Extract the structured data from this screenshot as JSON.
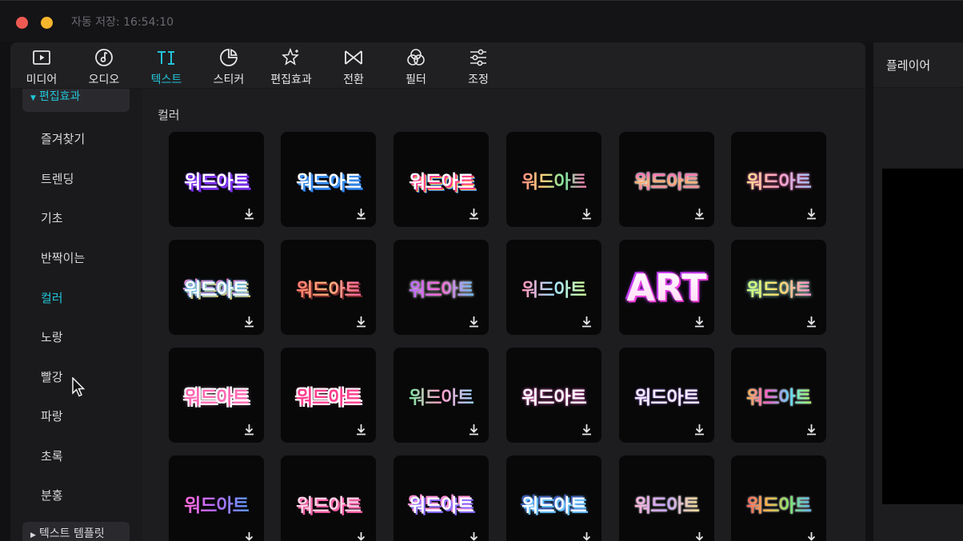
{
  "window": {
    "autosave_text": "자동 저장: 16:54:10",
    "colors": {
      "accent": "#22c4d8",
      "close": "#ee5a52",
      "minimize": "#f5b52d"
    }
  },
  "toolbar": {
    "tabs": [
      {
        "label": "미디어",
        "icon": "media-icon"
      },
      {
        "label": "오디오",
        "icon": "audio-icon"
      },
      {
        "label": "텍스트",
        "icon": "text-icon",
        "active": true
      },
      {
        "label": "스티커",
        "icon": "sticker-icon"
      },
      {
        "label": "편집효과",
        "icon": "effects-icon"
      },
      {
        "label": "전환",
        "icon": "transition-icon"
      },
      {
        "label": "필터",
        "icon": "filter-icon"
      },
      {
        "label": "조정",
        "icon": "adjust-icon"
      }
    ]
  },
  "sidebar": {
    "category_header": "편집효과",
    "items": [
      {
        "label": "즐겨찾기"
      },
      {
        "label": "트렌딩"
      },
      {
        "label": "기초"
      },
      {
        "label": "반짝이는"
      },
      {
        "label": "컬러",
        "active": true
      },
      {
        "label": "노랑"
      },
      {
        "label": "빨강"
      },
      {
        "label": "파랑"
      },
      {
        "label": "초록"
      },
      {
        "label": "분홍"
      }
    ],
    "category_footer": "텍스트 템플릿"
  },
  "content": {
    "section_title": "컬러",
    "tiles": [
      {
        "text": "워드아트",
        "icon": "download-icon"
      },
      {
        "text": "워드아트",
        "icon": "download-icon"
      },
      {
        "text": "워드아트",
        "icon": "download-icon"
      },
      {
        "text": "워드아트",
        "icon": "download-icon"
      },
      {
        "text": "워드아트",
        "icon": "download-icon"
      },
      {
        "text": "워드아트",
        "icon": "download-icon"
      },
      {
        "text": "워드아트",
        "icon": "download-icon"
      },
      {
        "text": "워드아트",
        "icon": "download-icon"
      },
      {
        "text": "워드아트",
        "icon": "download-icon"
      },
      {
        "text": "워드아트",
        "icon": "download-icon"
      },
      {
        "text": "ART",
        "icon": "download-icon"
      },
      {
        "text": "워드아트",
        "icon": "download-icon"
      },
      {
        "text": "워드아트",
        "icon": "download-icon"
      },
      {
        "text": "워드아트",
        "icon": "download-icon"
      },
      {
        "text": "워드아트",
        "icon": "download-icon"
      },
      {
        "text": "워드아트",
        "icon": "download-icon"
      },
      {
        "text": "워드아트",
        "icon": "download-icon"
      },
      {
        "text": "워드아트",
        "icon": "download-icon"
      },
      {
        "text": "워드아트",
        "icon": "download-icon"
      },
      {
        "text": "워드아트",
        "icon": "download-icon"
      },
      {
        "text": "워드아트",
        "icon": "download-icon"
      },
      {
        "text": "워드아트",
        "icon": "download-icon"
      },
      {
        "text": "워드아트",
        "icon": "download-icon"
      },
      {
        "text": "워드아트",
        "icon": "download-icon"
      }
    ]
  },
  "player": {
    "title": "플레이어"
  }
}
